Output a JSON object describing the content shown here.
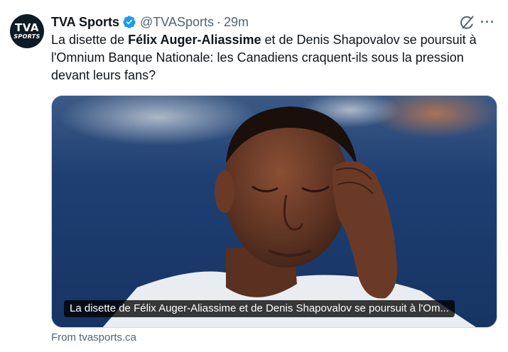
{
  "tweet": {
    "avatar": {
      "logo_top": "TVA",
      "logo_bottom": "SPORTS"
    },
    "author_name": "TVA Sports",
    "verified": true,
    "handle": "@TVASports",
    "separator": "·",
    "time": "29m",
    "more_label": "···",
    "text_part1": "La disette de ",
    "text_bold": "Félix Auger-Aliassime",
    "text_part2": " et de Denis Shapovalov se poursuit à l'Omnium Banque Nationale: les Canadiens craquent-ils sous la pression devant leurs fans?",
    "card": {
      "caption": "La disette de Félix Auger-Aliassime et de Denis Shapovalov se poursuit à l'Om...",
      "source": "From tvasports.ca"
    }
  },
  "colors": {
    "text": "#0f1419",
    "secondary": "#536471",
    "verified": "#1d9bf0",
    "border": "#cfd9de"
  },
  "icons": [
    "verified-badge-icon",
    "grok-icon",
    "more-icon"
  ]
}
